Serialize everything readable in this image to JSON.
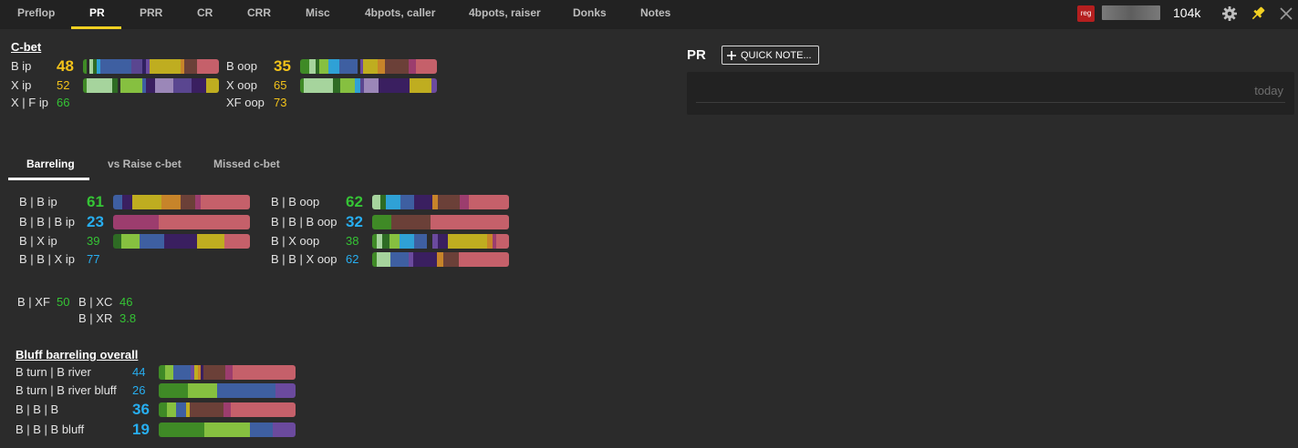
{
  "tabs": [
    "Preflop",
    "PR",
    "PRR",
    "CR",
    "CRR",
    "Misc",
    "4bpots, caller",
    "4bpots, raiser",
    "Donks",
    "Notes"
  ],
  "player": {
    "badge": "reg",
    "stack": "104k"
  },
  "icons": {
    "settings": "gear-icon",
    "pin": "pin-icon",
    "close": "close-icon"
  },
  "colors": {
    "yellow": "#f2c21a",
    "green": "#35c435",
    "blue": "#27aef0",
    "accent": "#f2d022"
  },
  "cbet": {
    "title": "C-bet",
    "left": [
      {
        "label": "B ip",
        "value": "48"
      },
      {
        "label": "X ip",
        "value": "52"
      },
      {
        "label": "X | F ip",
        "value": "66"
      }
    ],
    "right": [
      {
        "label": "B oop",
        "value": "35"
      },
      {
        "label": "X oop",
        "value": "65"
      },
      {
        "label": "XF oop",
        "value": "73"
      }
    ]
  },
  "subtabs": [
    "Barreling",
    "vs Raise c-bet",
    "Missed c-bet"
  ],
  "barreling": {
    "left": [
      {
        "label": "B | B ip",
        "value": "61"
      },
      {
        "label": "B | B | B ip",
        "value": "23"
      },
      {
        "label": "B | X  ip",
        "value": "39"
      },
      {
        "label": "B | B | X ip",
        "value": "77"
      }
    ],
    "right": [
      {
        "label": "B | B oop",
        "value": "62"
      },
      {
        "label": "B | B | B oop",
        "value": "32"
      },
      {
        "label": "B | X oop",
        "value": "38"
      },
      {
        "label": "B | B | X oop",
        "value": "62"
      }
    ]
  },
  "xf": [
    {
      "label": "B | XF",
      "value": "50"
    },
    {
      "label": "B | XC",
      "value": "46"
    },
    {
      "label": "B | XR",
      "value": "3.8"
    }
  ],
  "bluff": {
    "title": "Bluff barreling overall",
    "rows": [
      {
        "label": "B turn | B river",
        "value": "44"
      },
      {
        "label": "B turn | B river bluff",
        "value": "26"
      },
      {
        "label": "B | B | B",
        "value": "36"
      },
      {
        "label": "B | B | B bluff",
        "value": "19"
      }
    ]
  },
  "notes": {
    "title": "PR",
    "quick_note_label": "QUICK NOTE...",
    "date": "today"
  }
}
